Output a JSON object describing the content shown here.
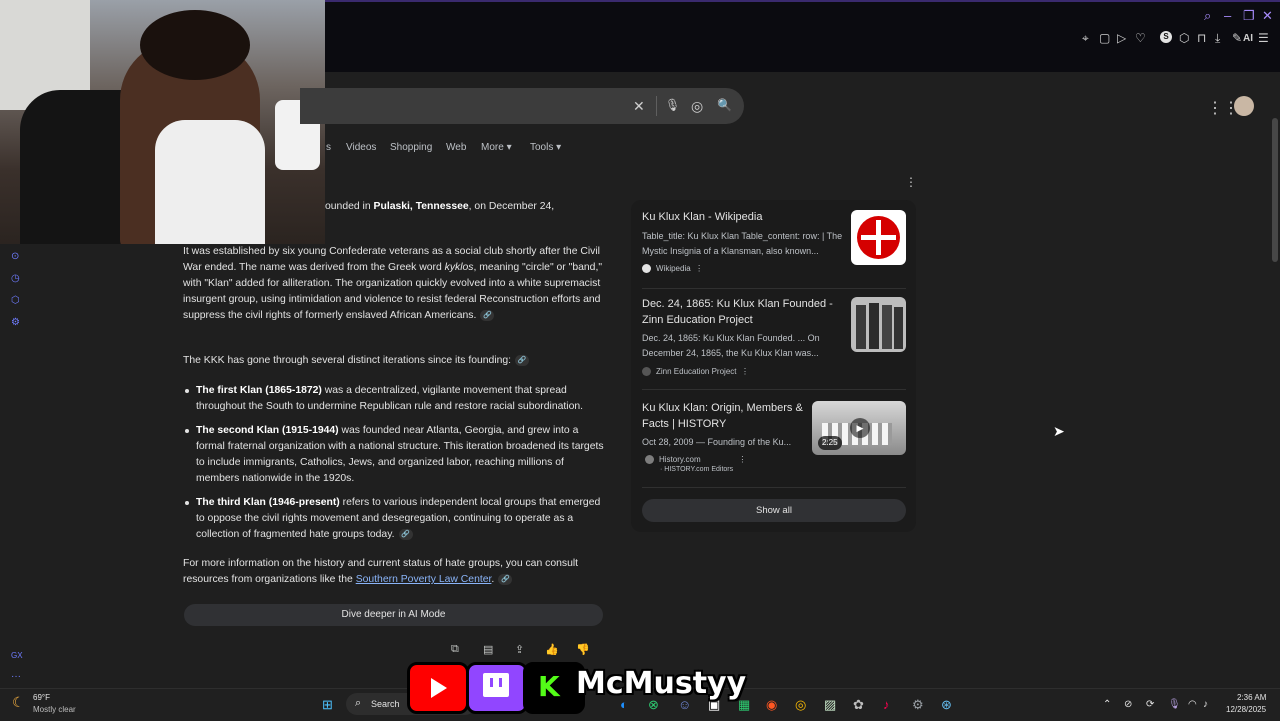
{
  "browser": {
    "window_controls": [
      "search-icon",
      "minimize-icon",
      "restore-icon",
      "close-icon"
    ],
    "toolbar_icons": [
      "bookmark-icon",
      "screenshot-icon",
      "play-icon",
      "heart-icon",
      "s-extension-icon",
      "puzzle-icon",
      "lock-icon",
      "download-icon",
      "ai-icon",
      "menu-icon"
    ],
    "ai_label": "AI",
    "s_badge": "S"
  },
  "search": {
    "clear_icon": "✕",
    "mic_icon": "🎙",
    "lens_icon": "◎",
    "search_icon": "🔍"
  },
  "tabs": {
    "partial": "s",
    "videos": "Videos",
    "shopping": "Shopping",
    "web": "Web",
    "more": "More",
    "tools": "Tools"
  },
  "ai_overview": {
    "intro_tail": "ounded in",
    "intro_place": "Pulaski, Tennessee",
    "intro_date": ", on December 24,",
    "p1": "It was established by six young Confederate veterans as a social club shortly after the Civil War ended. The name was derived from the Greek word",
    "p1_greek": "kyklos",
    "p1_rest": ", meaning \"circle\" or \"band,\" with \"Klan\" added for alliteration. The organization quickly evolved into a white supremacist insurgent group, using intimidation and violence to resist federal Reconstruction efforts and suppress the civil rights of formerly enslaved African Americans.",
    "p2": "The KKK has gone through several distinct iterations since its founding:",
    "items": [
      {
        "bold": "The first Klan (1865-1872)",
        "text": " was a decentralized, vigilante movement that spread throughout the South to undermine Republican rule and restore racial subordination."
      },
      {
        "bold": "The second Klan (1915-1944)",
        "text": " was founded near Atlanta, Georgia, and grew into a formal fraternal organization with a national structure. This iteration broadened its targets to include immigrants, Catholics, Jews, and organized labor, reaching millions of members nationwide in the 1920s."
      },
      {
        "bold": "The third Klan (1946-present)",
        "text": " refers to various independent local groups that emerged to oppose the civil rights movement and desegregation, continuing to operate as a collection of fragmented hate groups today."
      }
    ],
    "p3": "For more information on the history and current status of hate groups, you can consult resources from organizations like the",
    "p3_link": "Southern Poverty Law Center",
    "p3_end": ".",
    "dive_button": "Dive deeper in AI Mode"
  },
  "sources": [
    {
      "title": "Ku Klux Klan - Wikipedia",
      "snippet": "Table_title: Ku Klux Klan Table_content: row: | The Mystic Insignia of a Klansman, also known...",
      "source": "Wikipedia"
    },
    {
      "title": "Dec. 24, 1865: Ku Klux Klan Founded - Zinn Education Project",
      "snippet": "Dec. 24, 1865: Ku Klux Klan Founded. ... On December 24, 1865, the Ku Klux Klan was...",
      "source": "Zinn Education Project"
    },
    {
      "title": "Ku Klux Klan: Origin, Members & Facts | HISTORY",
      "snippet": "Oct 28, 2009 — Founding of the Ku...",
      "source": "History.com",
      "source_sub": "· HISTORY.com Editors",
      "duration": "2:25"
    }
  ],
  "show_all": "Show all",
  "overlay": {
    "channel_name": "McMustyy"
  },
  "taskbar": {
    "weather_temp": "69°F",
    "weather_desc": "Mostly clear",
    "search_label": "Search",
    "time": "2:36 AM",
    "date": "12/28/2025"
  },
  "left_rail_label": "GX",
  "colors": {
    "background": "#1f1f1f",
    "link": "#8ab4f8",
    "accent_purple": "#a78bfa",
    "youtube_red": "#ff0000",
    "twitch_purple": "#9146ff",
    "kick_green": "#53fc18"
  }
}
